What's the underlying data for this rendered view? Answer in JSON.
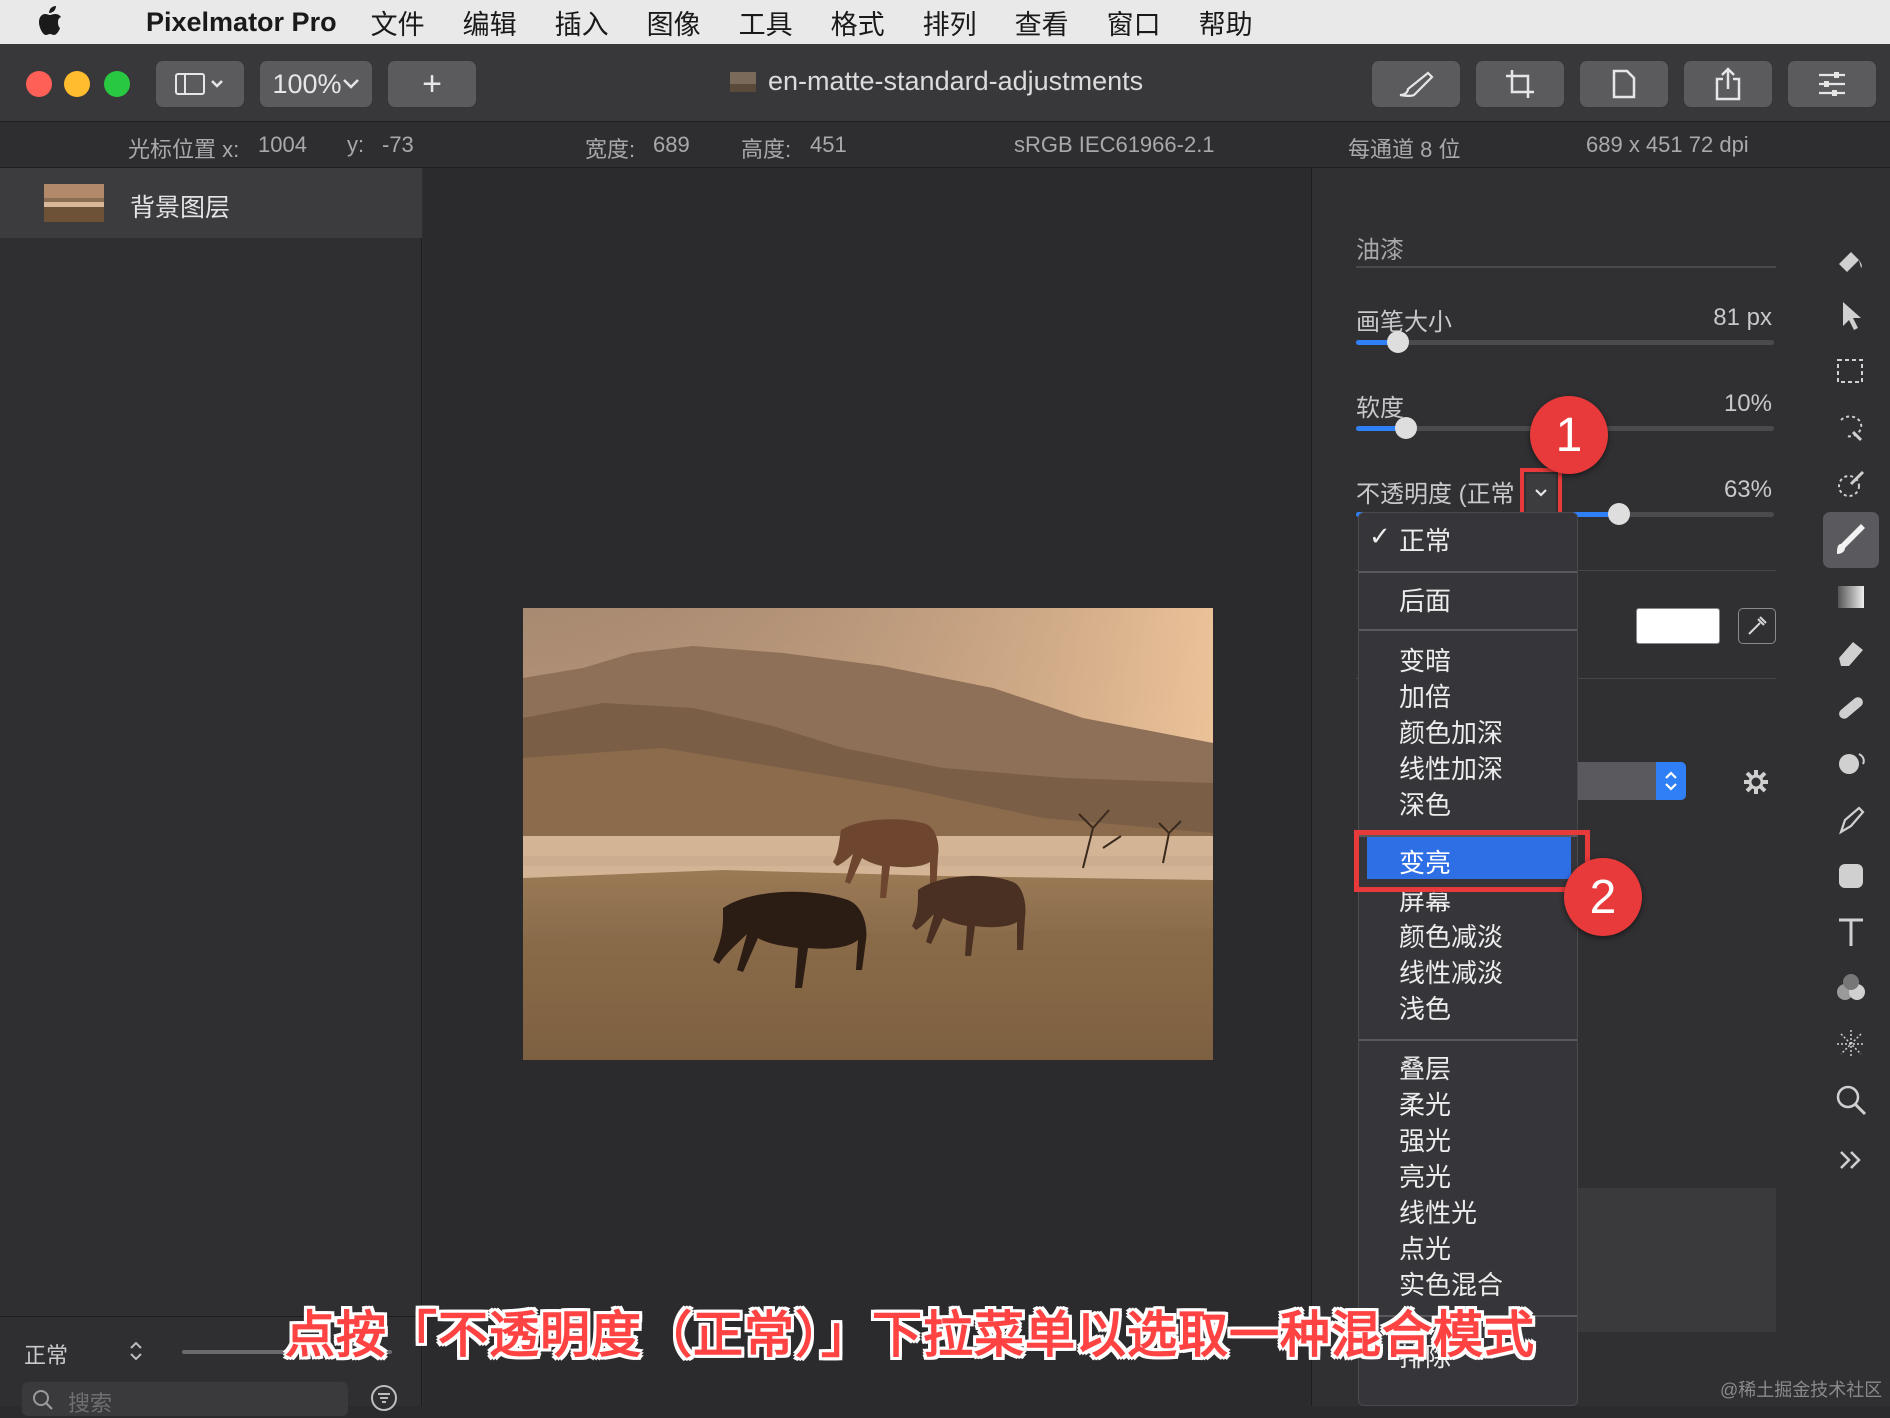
{
  "menubar": {
    "app_name": "Pixelmator Pro",
    "items": [
      "文件",
      "编辑",
      "插入",
      "图像",
      "工具",
      "格式",
      "排列",
      "查看",
      "窗口",
      "帮助"
    ]
  },
  "toolbar": {
    "zoom_label": "100%",
    "add_label": "+",
    "document_title": "en-matte-standard-adjustments"
  },
  "infobar": {
    "cursor_x_label": "光标位置 x:",
    "cursor_x_value": "1004",
    "cursor_y_label": "y:",
    "cursor_y_value": "-73",
    "width_label": "宽度:",
    "width_value": "689",
    "height_label": "高度:",
    "height_value": "451",
    "color_profile": "sRGB IEC61966-2.1",
    "bit_depth": "每通道 8 位",
    "size_dpi": "689 x 451 72 dpi"
  },
  "layers": {
    "items": [
      {
        "name": "背景图层"
      }
    ],
    "blend_mode": "正常",
    "search_placeholder": "搜索"
  },
  "paint_panel": {
    "section_title": "油漆",
    "brush_size_label": "画笔大小",
    "brush_size_value": "81 px",
    "brush_size_level": 0.1,
    "softness_label": "软度",
    "softness_value": "10%",
    "softness_level": 0.12,
    "opacity_label": "不透明度 (正常",
    "opacity_value": "63%",
    "opacity_level": 0.63,
    "color_swatch": "#ffffff"
  },
  "blend_menu": {
    "checked": "正常",
    "highlighted": "变亮",
    "group0": [
      "正常"
    ],
    "group1": [
      "后面"
    ],
    "group2": [
      "变暗",
      "加倍",
      "颜色加深",
      "线性加深",
      "深色"
    ],
    "group3": [
      "变亮",
      "屏幕",
      "颜色减淡",
      "线性减淡",
      "浅色"
    ],
    "group4": [
      "叠层",
      "柔光",
      "强光",
      "亮光",
      "线性光",
      "点光",
      "实色混合"
    ],
    "group5": [
      "排除"
    ]
  },
  "callouts": {
    "first": "1",
    "second": "2"
  },
  "caption": "点按「不透明度（正常）」下拉菜单以选取一种混合模式",
  "watermark": "@稀土掘金技术社区",
  "colors": {
    "accent": "#2f7ff7",
    "callout": "#e83a3a",
    "highlight_border": "#e83a3a"
  }
}
